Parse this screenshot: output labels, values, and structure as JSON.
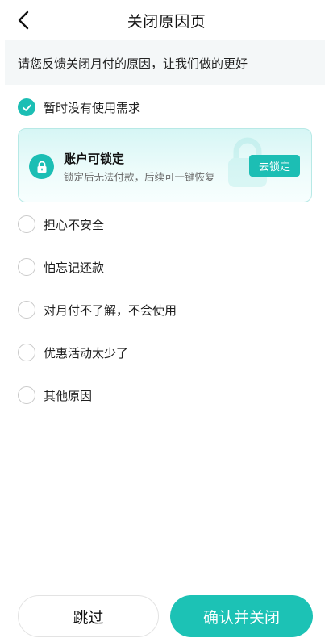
{
  "nav": {
    "title": "关闭原因页",
    "back_icon": "chevron-left-icon"
  },
  "banner": {
    "text": "请您反馈关闭月付的原因，让我们做的更好"
  },
  "options": [
    {
      "label": "暂时没有使用需求",
      "checked": true
    },
    {
      "label": "担心不安全",
      "checked": false
    },
    {
      "label": "怕忘记还款",
      "checked": false
    },
    {
      "label": "对月付不了解，不会使用",
      "checked": false
    },
    {
      "label": "优惠活动太少了",
      "checked": false
    },
    {
      "label": "其他原因",
      "checked": false
    }
  ],
  "lock_card": {
    "title": "账户可锁定",
    "desc": "锁定后无法付款，后续可一键恢复",
    "button": "去锁定",
    "icon": "lock-icon"
  },
  "footer": {
    "skip_label": "跳过",
    "confirm_label": "确认并关闭"
  },
  "colors": {
    "accent": "#1cbeb4",
    "card_bg": "#d6f6f5",
    "banner_bg": "#f4f7f8"
  }
}
